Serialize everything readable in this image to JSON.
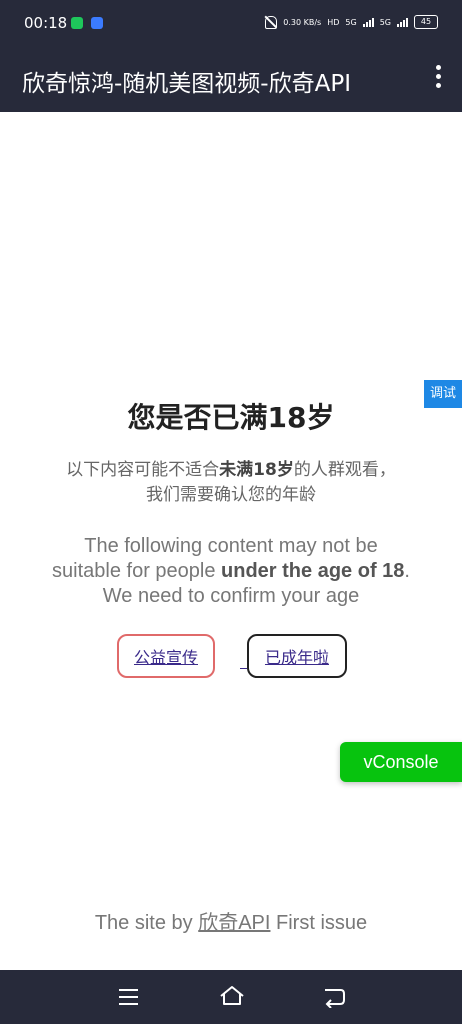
{
  "status_bar": {
    "time": "00:18",
    "network_speed": "0.30 KB/s",
    "hd_badge": "HD",
    "signal_1": "5G",
    "signal_2": "5G",
    "battery": "45"
  },
  "app_bar": {
    "title": "欣奇惊鸿-随机美图视频-欣奇API",
    "menu_icon": "more-vert-icon"
  },
  "age_gate": {
    "heading": "您是否已满18岁",
    "cn_line1_prefix": "以下内容可能不适合",
    "cn_line1_bold": "未满18岁",
    "cn_line1_suffix": "的人群观看，",
    "cn_line2": "我们需要确认您的年龄",
    "en_line1": "The following content may not be",
    "en_line2_prefix": "suitable for people ",
    "en_line2_bold": "under the age of 18",
    "en_line2_suffix": ".",
    "en_line3": "We need to confirm your age",
    "btn_charity": "公益宣传",
    "btn_adult": "已成年啦"
  },
  "debug_tab": "调试",
  "vconsole_label": "vConsole",
  "footer": {
    "prefix": "The site by ",
    "link": "欣奇API",
    "suffix": " First issue"
  },
  "colors": {
    "bar_bg": "#272a3a",
    "charity_border": "#e06a6a",
    "adult_border": "#222222",
    "debug_tab": "#1e88e5",
    "vconsole": "#07c30e"
  },
  "nav_icons": [
    "menu-icon",
    "home-icon",
    "back-icon"
  ]
}
